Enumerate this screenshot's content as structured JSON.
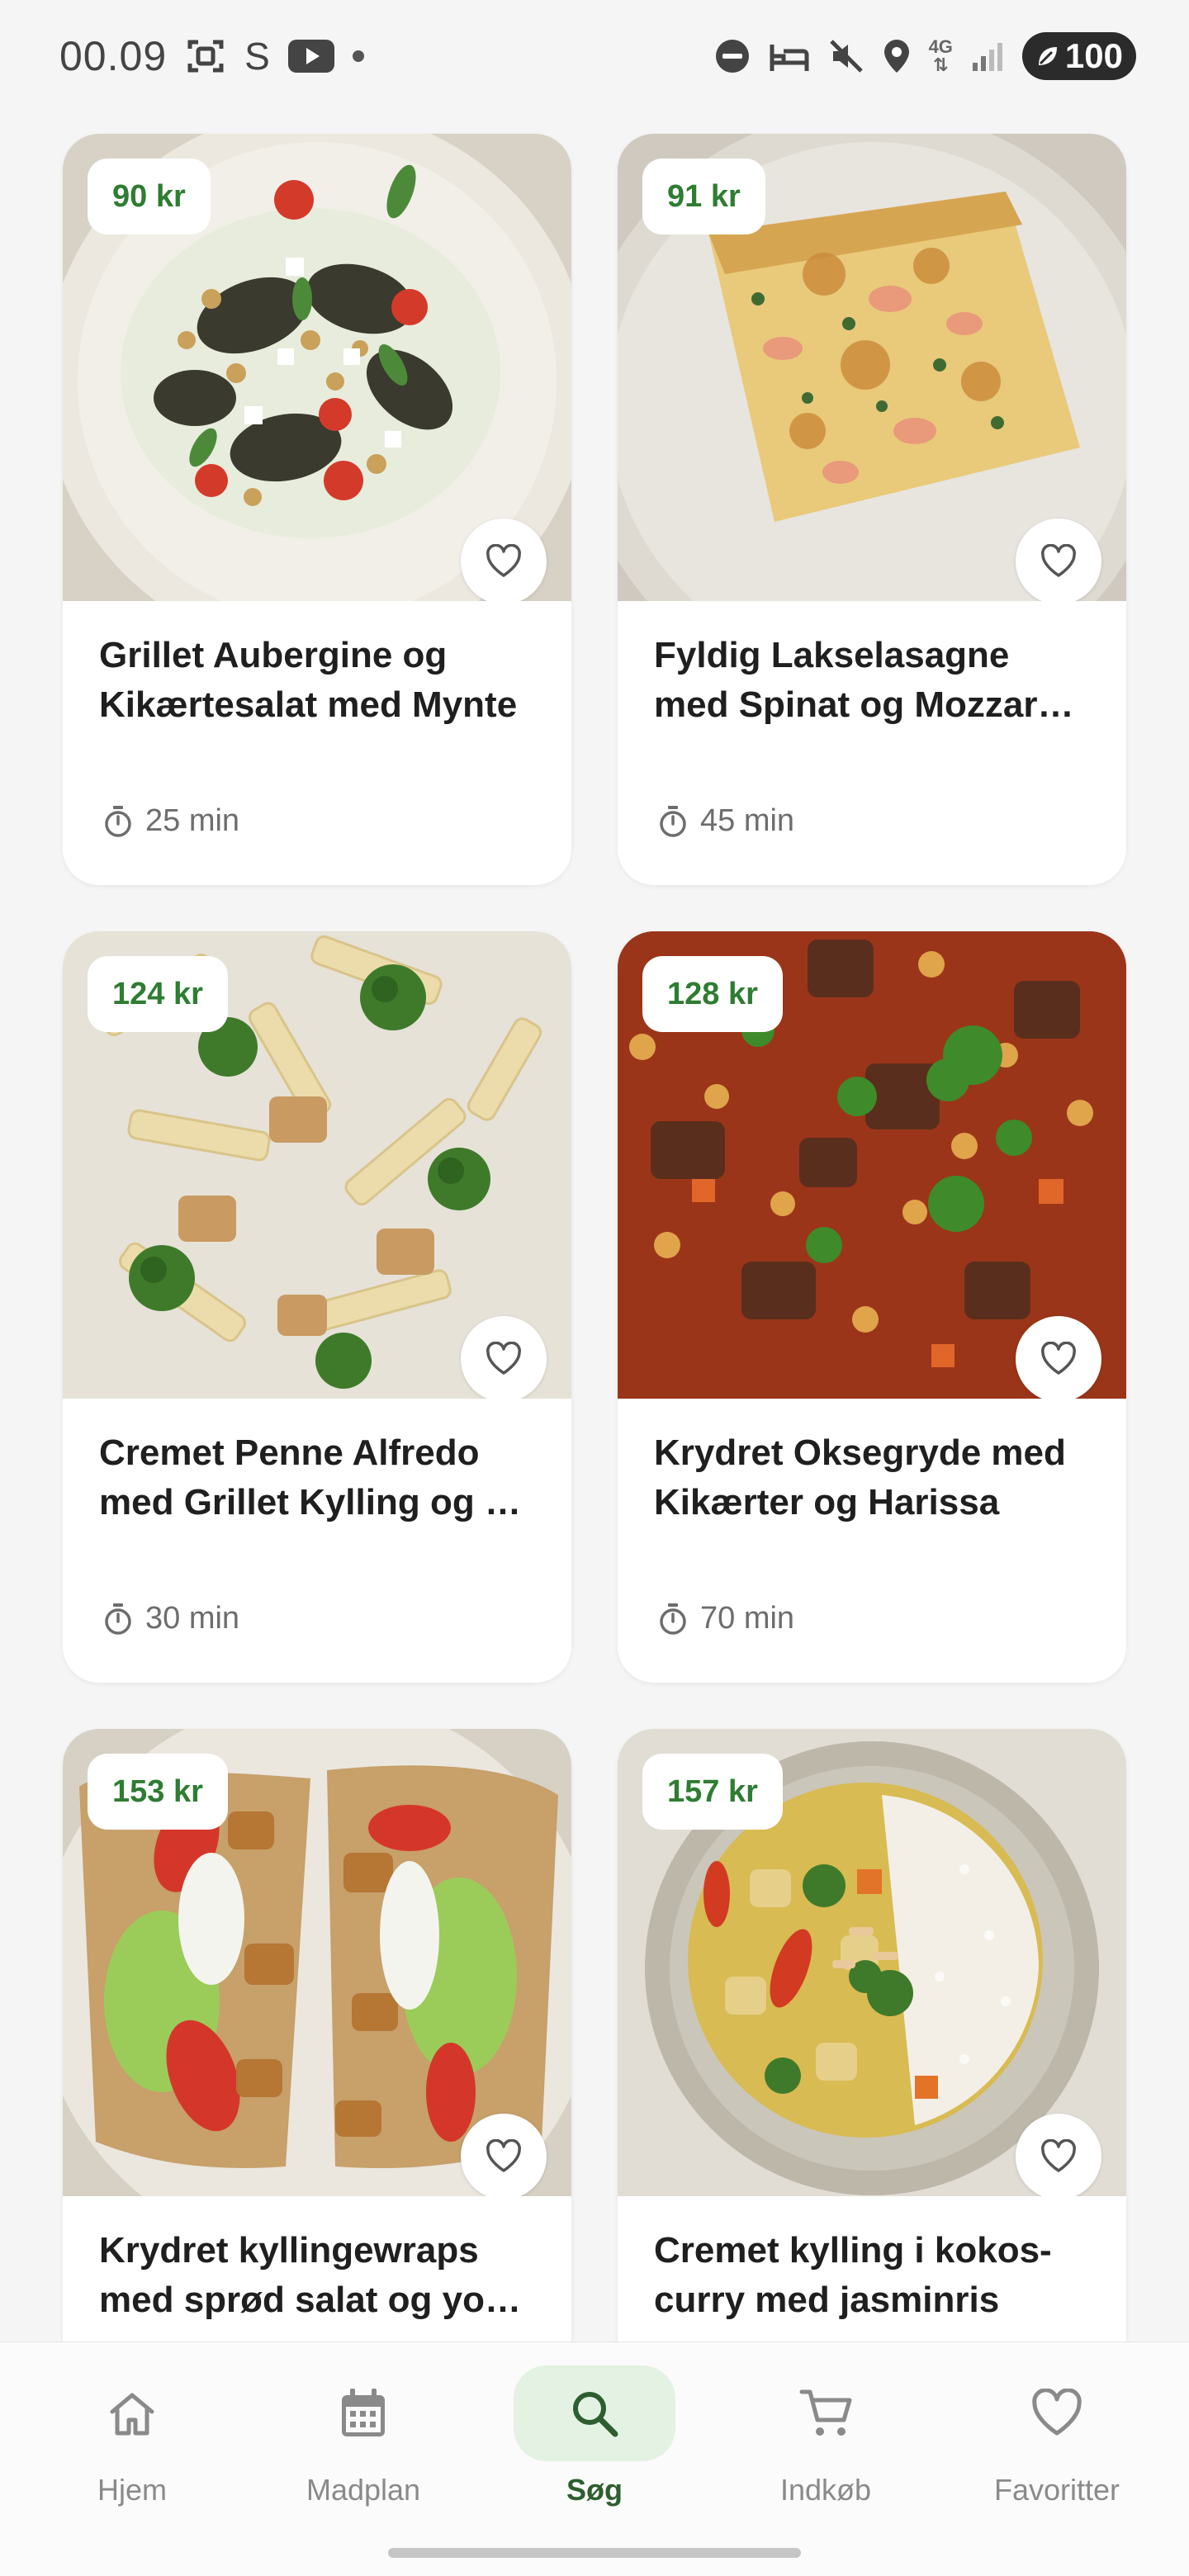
{
  "status_bar": {
    "time": "00.09",
    "letter": "S",
    "network": "4G",
    "battery": "100"
  },
  "recipes": [
    {
      "price": "90 kr",
      "title_line1": "Grillet Aubergine og",
      "title_line2": "Kikærtesalat med Mynte",
      "time": "25 min",
      "image": "eggplant-chickpea-salad"
    },
    {
      "price": "91 kr",
      "title_line1": "Fyldig Lakselasagne",
      "title_line2": "med Spinat og Mozzarella",
      "time": "45 min",
      "image": "salmon-lasagna"
    },
    {
      "price": "124 kr",
      "title_line1": "Cremet Penne Alfredo",
      "title_line2": "med Grillet Kylling og Broccoli",
      "time": "30 min",
      "image": "penne-alfredo"
    },
    {
      "price": "128 kr",
      "title_line1": "Krydret Oksegryde med",
      "title_line2": "Kikærter og Harissa",
      "time": "70 min",
      "image": "beef-stew"
    },
    {
      "price": "153 kr",
      "title_line1": "Krydret kyllingewraps",
      "title_line2": "med sprød salat og yoghurt",
      "time": "",
      "image": "chicken-wraps"
    },
    {
      "price": "157 kr",
      "title_line1": "Cremet kylling i kokos-",
      "title_line2": "curry med jasminris",
      "time": "",
      "image": "coconut-curry"
    }
  ],
  "nav": {
    "items": [
      {
        "label": "Hjem",
        "icon": "home-icon"
      },
      {
        "label": "Madplan",
        "icon": "calendar-icon"
      },
      {
        "label": "Søg",
        "icon": "search-icon"
      },
      {
        "label": "Indkøb",
        "icon": "cart-icon"
      },
      {
        "label": "Favoritter",
        "icon": "heart-icon"
      }
    ],
    "active": "Søg"
  },
  "colors": {
    "accent": "#2e7d32",
    "active_nav_bg": "#e4f2e4",
    "background": "#f5f5f5"
  }
}
